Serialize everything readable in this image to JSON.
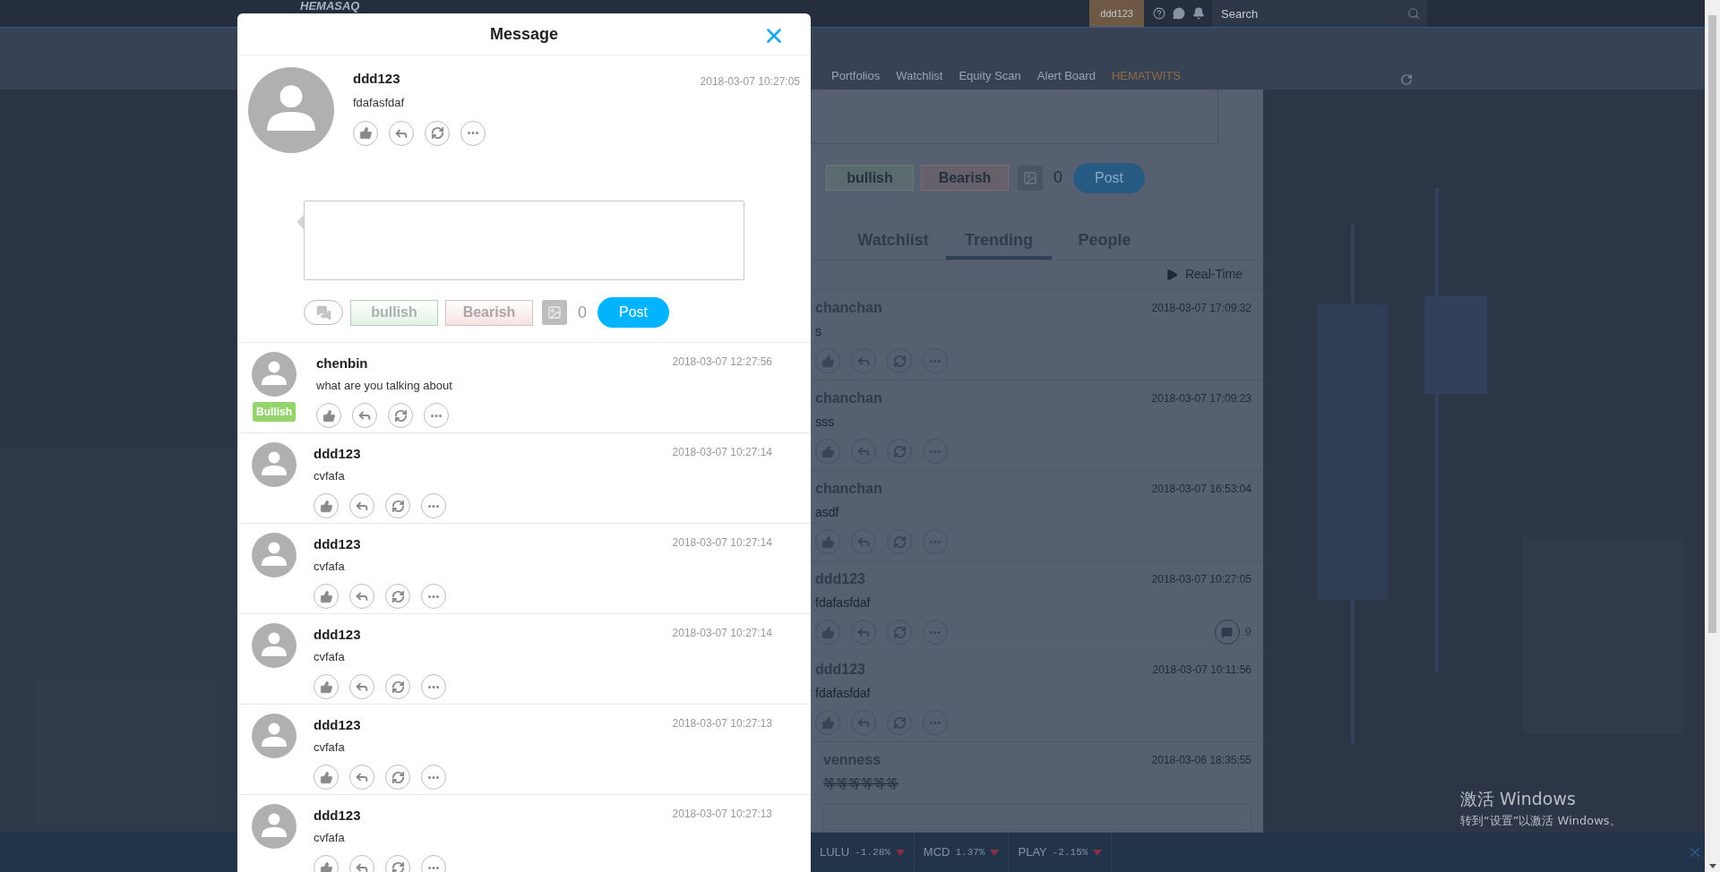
{
  "top_bar": {
    "logo": "HEMASAQ",
    "user_button": "ddd123",
    "search": {
      "placeholder": "Search"
    }
  },
  "nav": {
    "items": [
      {
        "label": "Portfolios",
        "selected": false
      },
      {
        "label": "Watchlist",
        "selected": false
      },
      {
        "label": "Equity Scan",
        "selected": false
      },
      {
        "label": "Alert Board",
        "selected": false
      },
      {
        "label": "HEMATWITS",
        "selected": true
      }
    ]
  },
  "composer": {
    "sentiment_buttons": [
      "bullish",
      "Bearish"
    ],
    "image_count": "0",
    "post_button": "Post"
  },
  "tabs": [
    {
      "label": "Watchlist",
      "selected": false
    },
    {
      "label": "Trending",
      "selected": true
    },
    {
      "label": "People",
      "selected": false
    }
  ],
  "realtime_label": "Real-Time",
  "feed": [
    {
      "user": "chanchan",
      "time": "2018-03-07 17:09:32",
      "text": "s",
      "struck": false
    },
    {
      "user": "chanchan",
      "time": "2018-03-07 17:09:23",
      "text": "sss",
      "struck": false
    },
    {
      "user": "chanchan",
      "time": "2018-03-07 16:53:04",
      "text": "asdf",
      "struck": false
    },
    {
      "user": "ddd123",
      "time": "2018-03-07 10:27:05",
      "text": "fdafasfdaf",
      "struck": false,
      "comment_count": "9"
    },
    {
      "user": "ddd123",
      "time": "2018-03-07 10:11:56",
      "text": "fdafasfdaf",
      "struck": false
    },
    {
      "user": "venness",
      "time": "2018-03-06 18:35:55",
      "text": "等等等等等等",
      "struck": true
    }
  ],
  "ticker": [
    {
      "symbol": "LULU",
      "change": "-1.28%",
      "falling": true
    },
    {
      "symbol": "MCD",
      "change": "1.37%",
      "falling": true
    },
    {
      "symbol": "PLAY",
      "change": "-2.15%",
      "falling": true
    }
  ],
  "os_notice": {
    "title": "激活 Windows",
    "subtitle": "转到“设置”以激活 Windows。"
  },
  "modal": {
    "title": "Message",
    "post": {
      "user": "ddd123",
      "time": "2018-03-07 10:27:05",
      "text": "fdafasfdaf"
    },
    "reply": {
      "sentiment_buttons": [
        "bullish",
        "Bearish"
      ],
      "image_count": "0",
      "post_button": "Post"
    },
    "replies": [
      {
        "user": "chenbin",
        "time": "2018-03-07 12:27:56",
        "text": "what are you talking about",
        "sentiment": "Bullish"
      },
      {
        "user": "ddd123",
        "time": "2018-03-07 10:27:14",
        "text": "cvfafa"
      },
      {
        "user": "ddd123",
        "time": "2018-03-07 10:27:14",
        "text": "cvfafa"
      },
      {
        "user": "ddd123",
        "time": "2018-03-07 10:27:14",
        "text": "cvfafa"
      },
      {
        "user": "ddd123",
        "time": "2018-03-07 10:27:13",
        "text": "cvfafa"
      },
      {
        "user": "ddd123",
        "time": "2018-03-07 10:27:13",
        "text": "cvfafa"
      }
    ]
  }
}
